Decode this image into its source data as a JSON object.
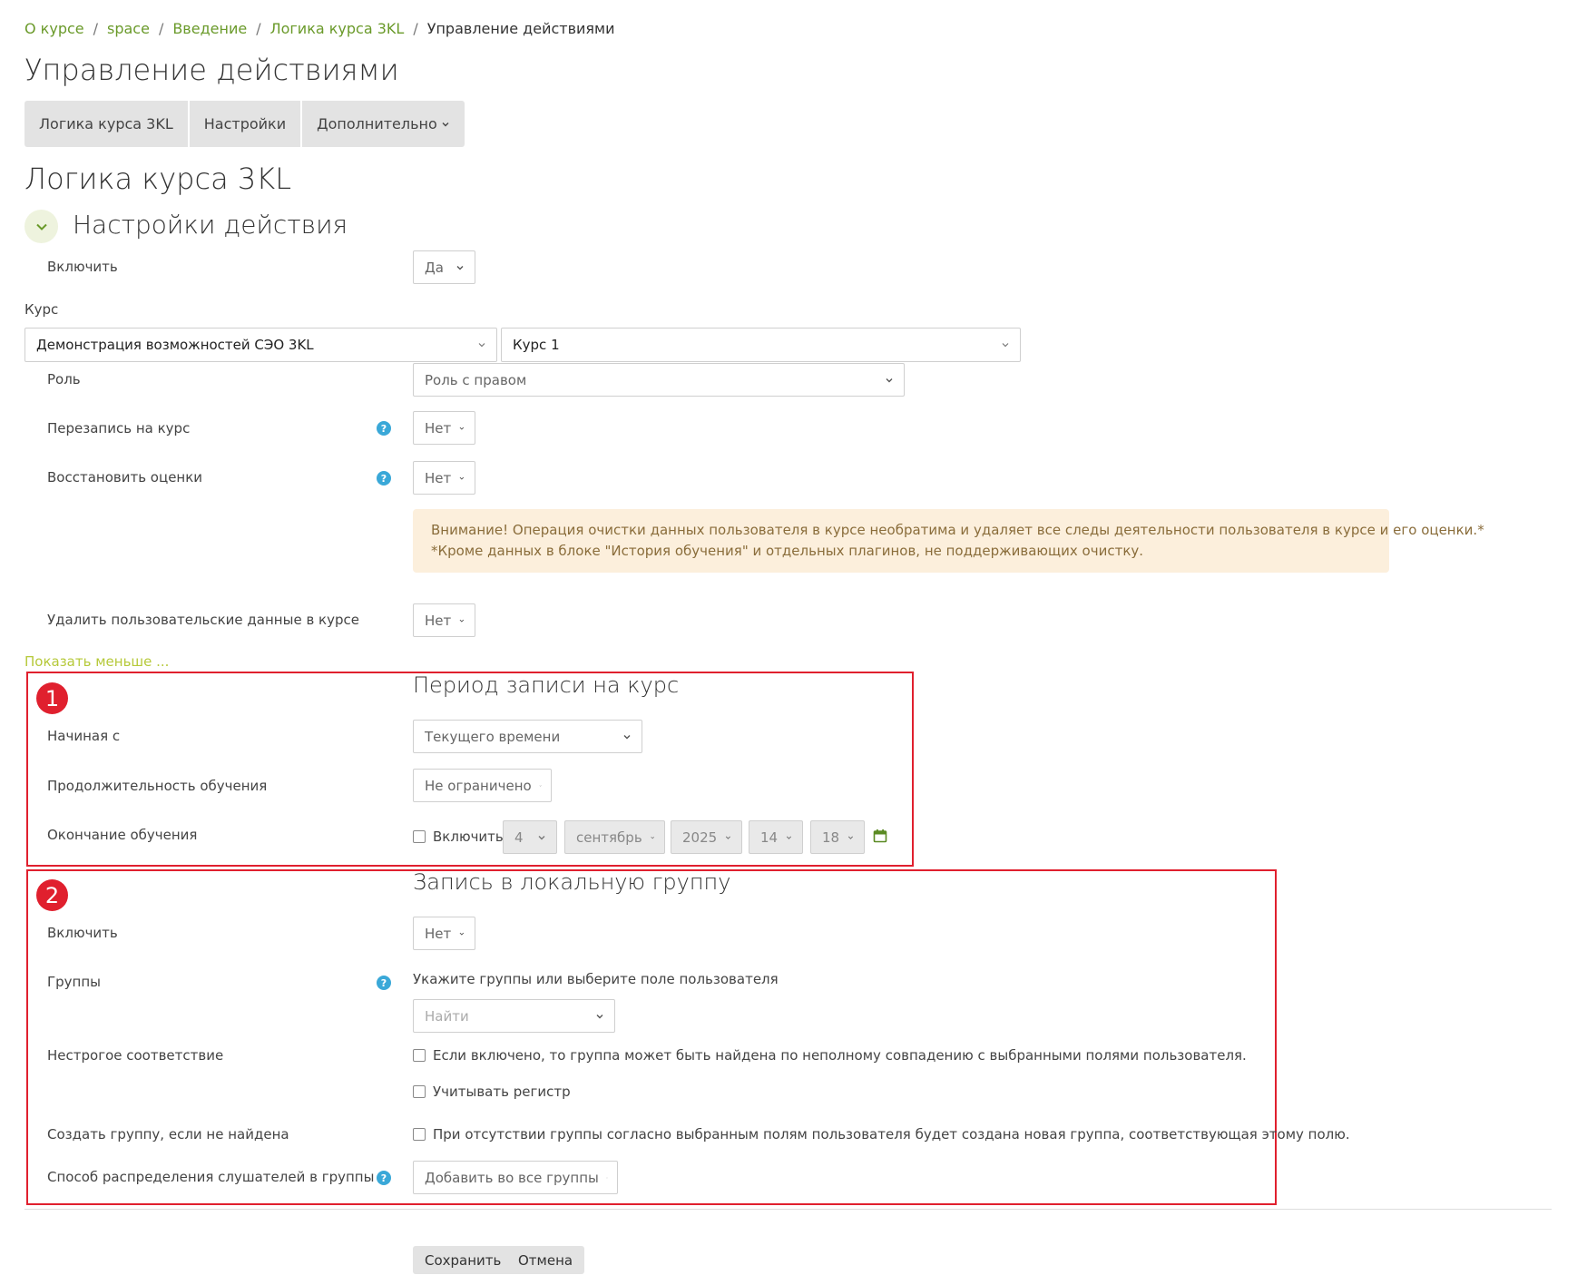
{
  "breadcrumb": {
    "items": [
      "О курсе",
      "space",
      "Введение",
      "Логика курса 3KL"
    ],
    "current": "Управление действиями",
    "separator": "/"
  },
  "page_title": "Управление действиями",
  "tabs": [
    {
      "label": "Логика курса 3KL"
    },
    {
      "label": "Настройки"
    },
    {
      "label": "Дополнительно"
    }
  ],
  "sub_title": "Логика курса 3KL",
  "section": {
    "title": "Настройки действия",
    "enable": {
      "label": "Включить",
      "value": "Да"
    },
    "course_label": "Курс",
    "course_category": "Демонстрация возможностей СЭО 3KL",
    "course_name": "Курс 1",
    "role": {
      "label": "Роль",
      "value": "Роль с правом"
    },
    "reenrol": {
      "label": "Перезапись на курс",
      "value": "Нет"
    },
    "restore_grades": {
      "label": "Восстановить оценки",
      "value": "Нет"
    },
    "alert": {
      "line1": "Внимание! Операция очистки данных пользователя в курсе необратима и удаляет все следы деятельности пользователя в курсе и его оценки.*",
      "line2": "*Кроме данных в блоке \"История обучения\" и отдельных плагинов, не поддерживающих очистку."
    },
    "delete_user_data": {
      "label": "Удалить пользовательские данные в курсе",
      "value": "Нет"
    },
    "show_less": "Показать меньше ..."
  },
  "period": {
    "badge": "1",
    "title": "Период записи на курс",
    "start": {
      "label": "Начиная с",
      "value": "Текущего времени"
    },
    "duration": {
      "label": "Продолжительность обучения",
      "value": "Не ограничено"
    },
    "end": {
      "label": "Окончание обучения",
      "enable_label": "Включить",
      "day": "4",
      "month": "сентябрь",
      "year": "2025",
      "hour": "14",
      "minute": "18"
    }
  },
  "group": {
    "badge": "2",
    "title": "Запись в локальную группу",
    "enable": {
      "label": "Включить",
      "value": "Нет"
    },
    "groups": {
      "label": "Группы",
      "hint": "Укажите группы или выберите поле пользователя",
      "placeholder": "Найти"
    },
    "loose_match": {
      "label": "Нестрогое соответствие",
      "checkbox1": "Если включено, то группа может быть найдена по неполному совпадению с выбранными полями пользователя.",
      "checkbox2": "Учитывать регистр"
    },
    "create": {
      "label": "Создать группу, если не найдена",
      "checkbox": "При отсутствии группы согласно выбранным полям пользователя будет создана новая группа, соответствующая этому полю."
    },
    "distribution": {
      "label": "Способ распределения слушателей в группы",
      "value": "Добавить во все группы"
    }
  },
  "buttons": {
    "save": "Сохранить",
    "cancel": "Отмена"
  },
  "colors": {
    "link": "#6a9a2a",
    "accent_red": "#e0202e",
    "help": "#3aa8d8",
    "alert_bg": "#fcefdc",
    "show_less": "#b6c93a"
  }
}
